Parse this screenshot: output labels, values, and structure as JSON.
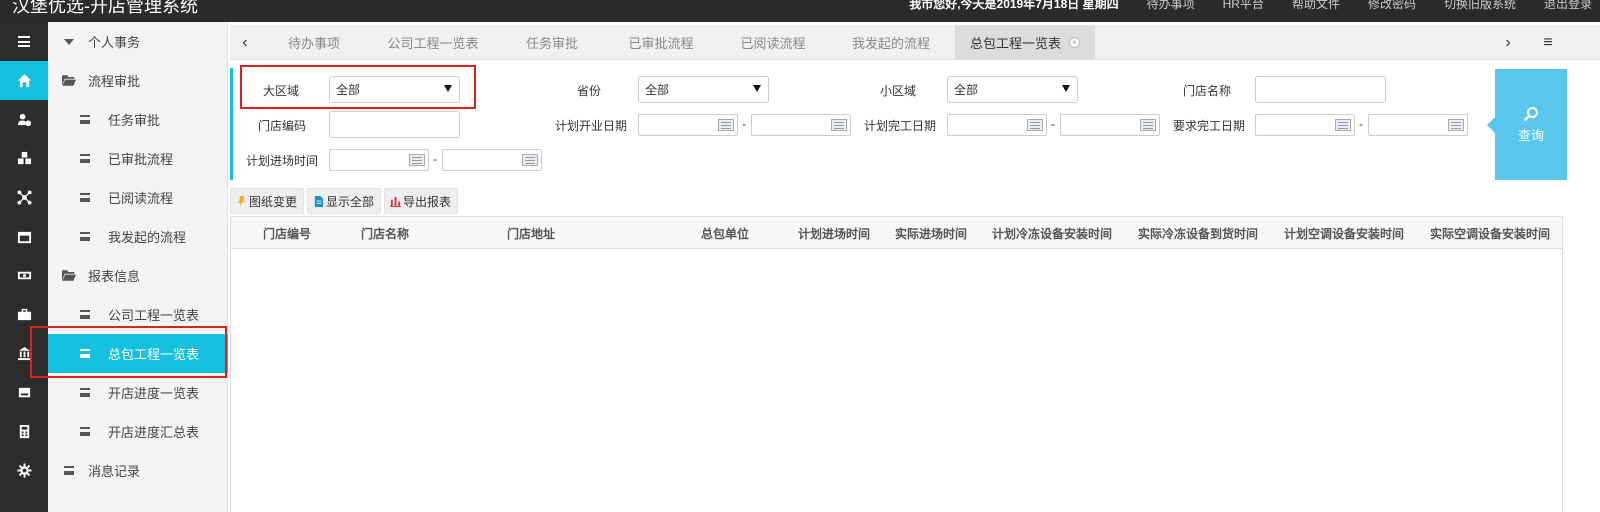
{
  "topbar": {
    "title": "汉堡优选-开店管理系统",
    "welcome": "我市您好,今天是2019年7月18日 星期四",
    "links": [
      "待办事项",
      "HR平台",
      "帮助文件",
      "修改密码",
      "切换旧版系统",
      "退出登录"
    ]
  },
  "rail": {
    "items": [
      {
        "icon": "menu-toggle-icon"
      },
      {
        "icon": "home-icon"
      },
      {
        "icon": "user-settings-icon"
      },
      {
        "icon": "cubes-icon"
      },
      {
        "icon": "network-icon"
      },
      {
        "icon": "calendar-icon"
      },
      {
        "icon": "money-icon"
      },
      {
        "icon": "briefcase-icon"
      },
      {
        "icon": "bank-icon"
      },
      {
        "icon": "hard-drive-icon"
      },
      {
        "icon": "calculator-icon"
      },
      {
        "icon": "gear-icon"
      }
    ]
  },
  "sidebar": {
    "items": [
      {
        "label": "个人事务",
        "icon": "caret-down-icon"
      },
      {
        "label": "流程审批",
        "icon": "folder-open-icon"
      },
      {
        "label": "任务审批",
        "icon": "list-icon"
      },
      {
        "label": "已审批流程",
        "icon": "list-icon"
      },
      {
        "label": "已阅读流程",
        "icon": "list-icon"
      },
      {
        "label": "我发起的流程",
        "icon": "list-icon"
      },
      {
        "label": "报表信息",
        "icon": "folder-open-icon"
      },
      {
        "label": "公司工程一览表",
        "icon": "list-icon"
      },
      {
        "label": "总包工程一览表",
        "icon": "list-icon"
      },
      {
        "label": "开店进度一览表",
        "icon": "list-icon"
      },
      {
        "label": "开店进度汇总表",
        "icon": "list-icon"
      },
      {
        "label": "消息记录",
        "icon": "list-icon"
      }
    ]
  },
  "tabs": {
    "prev": "‹",
    "next": "›",
    "menu": "≡",
    "items": [
      {
        "label": "待办事项"
      },
      {
        "label": "公司工程一览表"
      },
      {
        "label": "任务审批"
      },
      {
        "label": "已审批流程"
      },
      {
        "label": "已阅读流程"
      },
      {
        "label": "我发起的流程"
      },
      {
        "label": "总包工程一览表",
        "active": true
      }
    ]
  },
  "filters": {
    "region_label": "大区域",
    "region_value": "全部",
    "province_label": "省份",
    "province_value": "全部",
    "subregion_label": "小区域",
    "subregion_value": "全部",
    "store_name_label": "门店名称",
    "store_code_label": "门店编码",
    "planned_open_label": "计划开业日期",
    "planned_finish_label": "计划完工日期",
    "required_finish_label": "要求完工日期",
    "planned_entry_label": "计划进场时间",
    "range_sep": "-",
    "search_label": "查询"
  },
  "toolbar": {
    "change_label": "图纸变更",
    "show_all_label": "显示全部",
    "export_label": "导出报表"
  },
  "table": {
    "columns": [
      "门店编号",
      "门店名称",
      "门店地址",
      "总包单位",
      "计划进场时间",
      "实际进场时间",
      "计划冷冻设备安装时间",
      "实际冷冻设备到货时间",
      "计划空调设备安装时间",
      "实际空调设备安装时间"
    ],
    "rows": []
  }
}
